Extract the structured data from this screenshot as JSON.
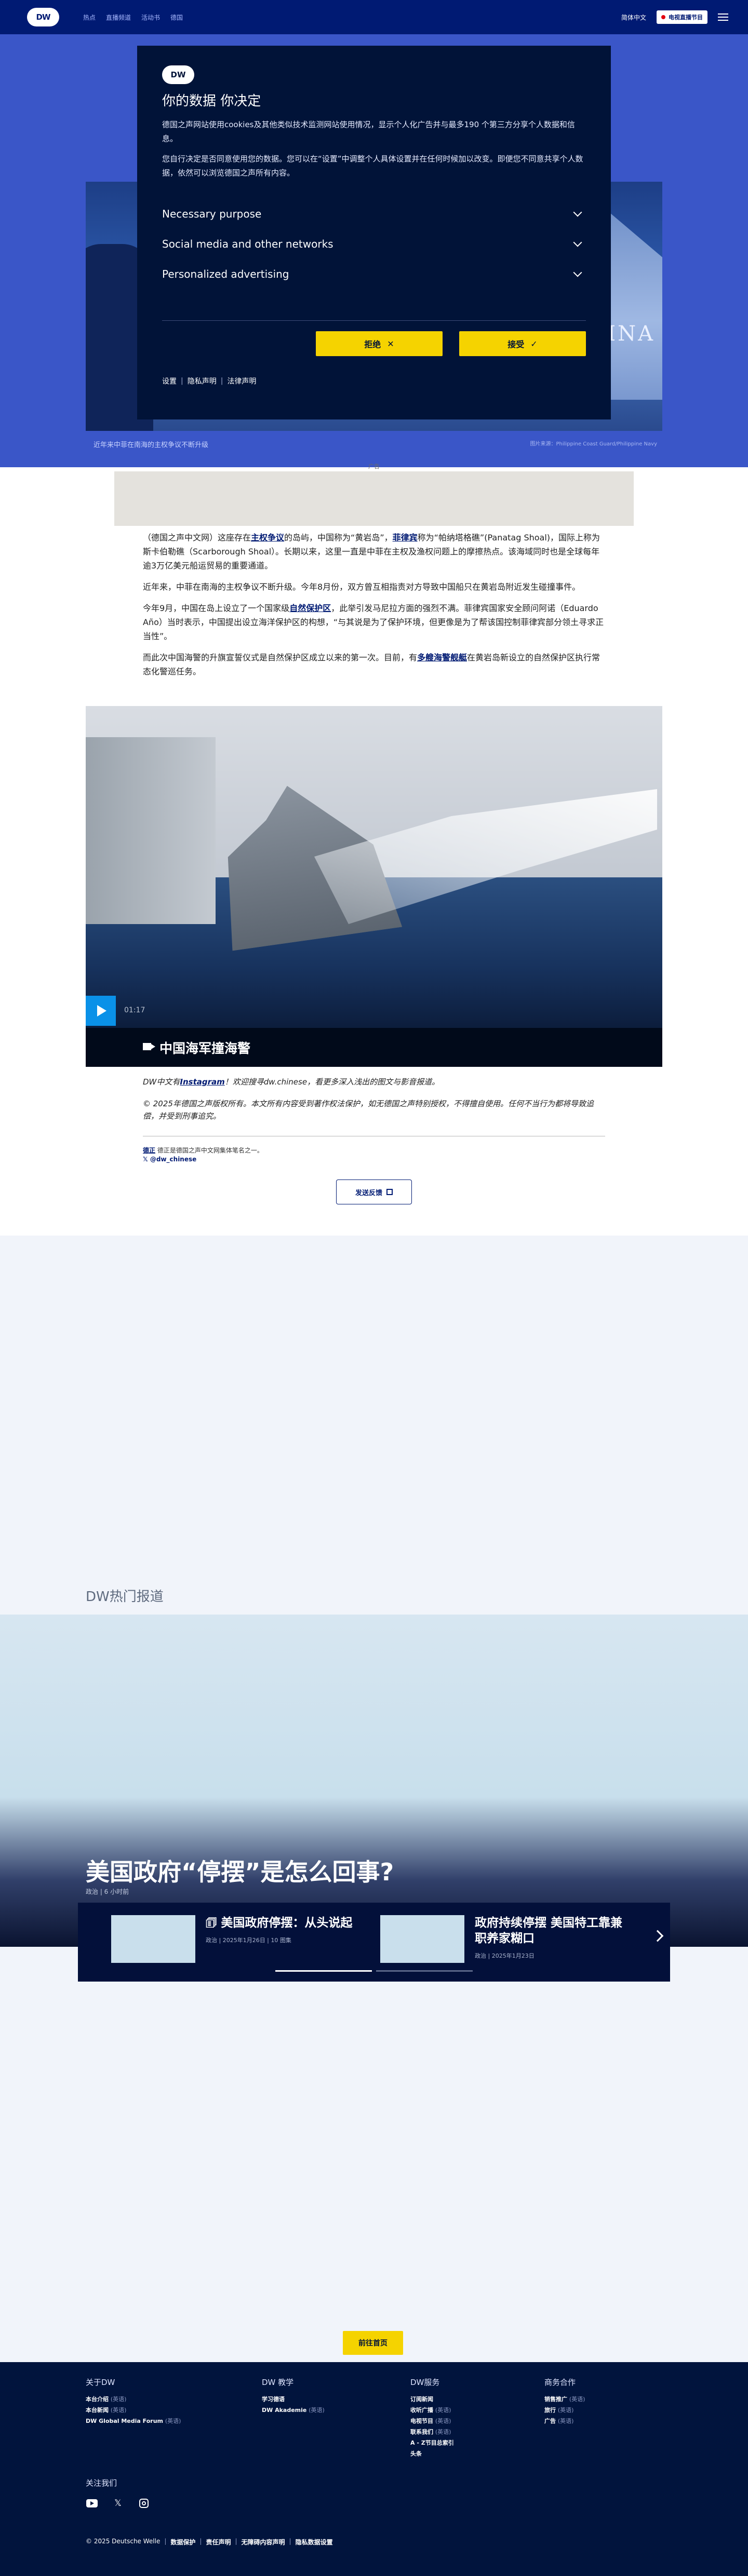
{
  "header": {
    "logo": "DW",
    "nav": [
      "热点",
      "直播频道",
      "活动书",
      "德国"
    ],
    "lang_label": "简体中文",
    "live_label": "电视直播节目"
  },
  "hero": {
    "hull_text": "INA",
    "caption": "近年来中菲在南海的主权争议不断升级",
    "credit": "图片来源：Philippine Coast Guard/Philippine Navy"
  },
  "cookie_modal": {
    "title": "你的数据 你决定",
    "intro": "德国之声网站使用cookies及其他类似技术监测网站使用情况，显示个人化广告并与最多190 个第三方分享个人数据和信息。",
    "intro2": "您自行决定是否同意使用您的数据。您可以在“设置”中调整个人具体设置并在任何时候加以改变。即便您不同意共享个人数据，依然可以浏览德国之声所有内容。",
    "accordion": [
      "Necessary purpose",
      "Social media and other networks",
      "Personalized advertising"
    ],
    "reject_label": "拒绝",
    "accept_label": "接受",
    "links": [
      "设置",
      "隐私声明",
      "法律声明"
    ]
  },
  "ad": {
    "label": "广告"
  },
  "article": {
    "p1_pre": "（德国之声中文网）这座存在",
    "p1_link1": "主权争议",
    "p1_mid": "的岛屿，中国称为“黄岩岛”，",
    "p1_link2": "菲律宾",
    "p1_post": "称为“帕纳塔格礁”(Panatag Shoal)，国际上称为斯卡伯勒礁（Scarborough Shoal）。长期以来，这里一直是中菲在主权及渔权问题上的摩擦热点。该海域同时也是全球每年逾3万亿美元船运贸易的重要通道。",
    "p2": "近年来，中菲在南海的主权争议不断升级。今年8月份，双方曾互相指责对方导致中国船只在黄岩岛附近发生碰撞事件。",
    "p3_pre": "今年9月，中国在岛上设立了一个国家级",
    "p3_link": "自然保护区",
    "p3_post": "，此举引发马尼拉方面的强烈不满。菲律宾国家安全顾问阿诺（Eduardo Año）当时表示，中国提出设立海洋保护区的构想，“与其说是为了保护环境，但更像是为了帮该国控制菲律宾部分领土寻求正当性”。",
    "p4_pre": "而此次中国海警的升旗宣誓仪式是自然保护区成立以来的第一次。目前，有",
    "p4_link": "多艘海警舰艇",
    "p4_post": "在黄岩岛新设立的自然保护区执行常态化警巡任务。"
  },
  "video": {
    "duration": "01:17",
    "title": "中国海军撞海警"
  },
  "notes": {
    "n1_pre": "DW中文有",
    "n1_link": "Instagram",
    "n1_post": "！欢迎搜寻dw.chinese，看更多深入浅出的图文与影音报道。",
    "n2": "© 2025年德国之声版权所有。本文所有内容受到著作权法保护，如无德国之声特别授权，不得擅自使用。任何不当行为都将导致追偿，并受到刑事追究。"
  },
  "author": {
    "name": "德正",
    "role": "德正是德国之声中文网集体笔名之一。",
    "handle": "@dw_chinese"
  },
  "feedback_label": "发送反馈",
  "hot": {
    "section_title": "DW热门报道",
    "headline": "美国政府“停摆”是怎么回事?",
    "meta": "政治 | 6 小时前",
    "cards": [
      {
        "title": "美国政府停摆：从头说起",
        "meta": "政治 | 2025年1月26日 | 10 图集"
      },
      {
        "title": "政府持续停摆 美国特工靠兼职养家糊口",
        "meta": "政治 | 2025年1月23日"
      }
    ]
  },
  "home_label": "前往首页",
  "footer": {
    "col1_title": "关于DW",
    "col1_items": [
      {
        "label": "本台介绍",
        "extra": "(英语)"
      },
      {
        "label": "本台新闻",
        "extra": "(英语)"
      },
      {
        "label": "DW Global Media Forum",
        "extra": "(英语)"
      }
    ],
    "col2_title": "DW 教学",
    "col2_items": [
      {
        "label": "学习德语",
        "extra": ""
      },
      {
        "label": "DW Akademie",
        "extra": "(英语)"
      }
    ],
    "col3_title": "DW服务",
    "col3_items": [
      {
        "label": "订阅新闻",
        "extra": ""
      },
      {
        "label": "收听广播",
        "extra": "(英语)"
      },
      {
        "label": "电视节目",
        "extra": "(英语)"
      },
      {
        "label": "联系我们",
        "extra": "(英语)"
      },
      {
        "label": "A - Z节目总索引",
        "extra": ""
      },
      {
        "label": "头条",
        "extra": ""
      }
    ],
    "col4_title": "商务合作",
    "col4_items": [
      {
        "label": "销售推广",
        "extra": "(英语)"
      },
      {
        "label": "旅行",
        "extra": "(英语)"
      },
      {
        "label": "广告",
        "extra": "(英语)"
      }
    ],
    "follow_label": "关注我们",
    "bottom_links": [
      "© 2025 Deutsche Welle",
      "数据保护",
      "责任声明",
      "无障碍内容声明",
      "隐私数据设置"
    ]
  }
}
